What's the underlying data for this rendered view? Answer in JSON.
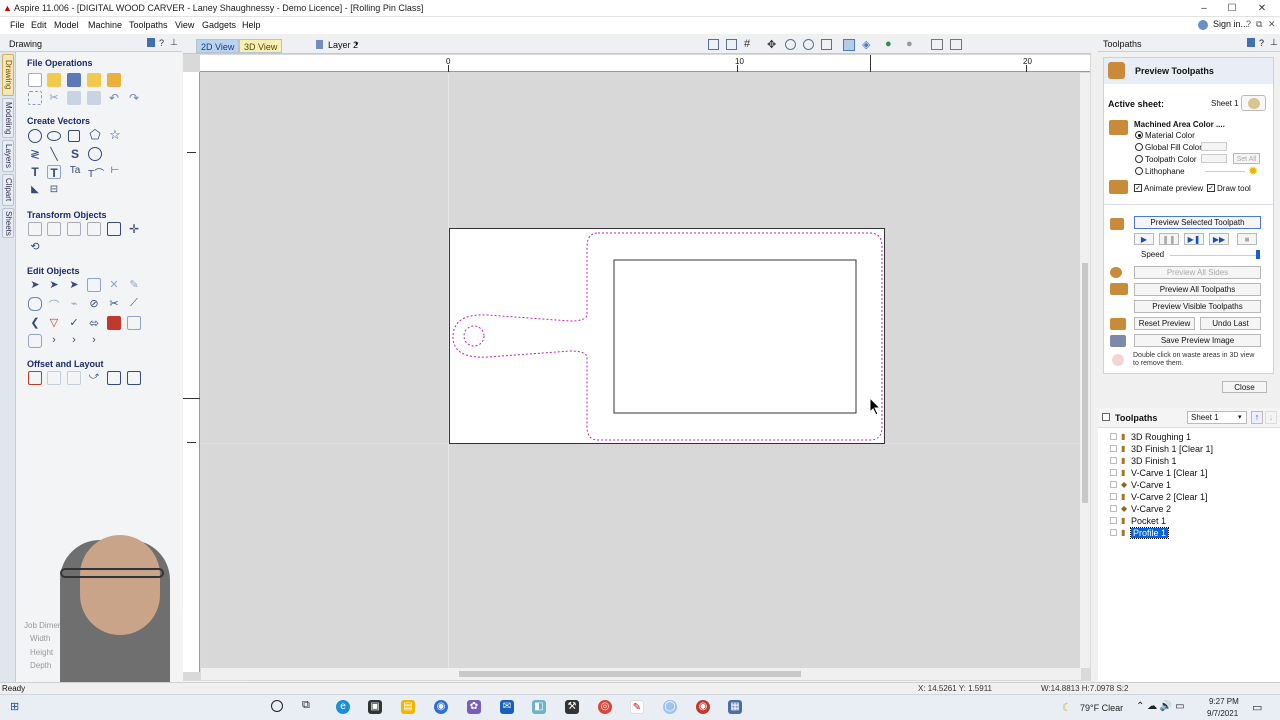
{
  "window": {
    "title": "Aspire 11.006 - [DIGITAL WOOD CARVER - Laney Shaughnessy - Demo Licence] - [Rolling Pin Class]",
    "controls": [
      "–",
      "☐",
      "✕"
    ]
  },
  "menu": {
    "items": [
      "File",
      "Edit",
      "Model",
      "Machine",
      "Toolpaths",
      "View",
      "Gadgets",
      "Help"
    ],
    "signin": "Sign in..."
  },
  "left_tabs": [
    "Drawing",
    "Modeling",
    "Layers",
    "Clipart",
    "Sheets"
  ],
  "drawing_panel": {
    "title": "Drawing",
    "sections": [
      {
        "title": "File Operations"
      },
      {
        "title": "Create Vectors"
      },
      {
        "title": "Transform Objects"
      },
      {
        "title": "Edit Objects"
      },
      {
        "title": "Offset and Layout"
      }
    ],
    "job_dimensions": {
      "title": "Job Dimen",
      "width": "Width",
      "height": "Height",
      "depth": "Depth"
    }
  },
  "view_tabs": {
    "tab_2d": "2D View",
    "tab_3d": "3D View",
    "layer": "Layer 2"
  },
  "ruler": {
    "labels": [
      "0",
      "10",
      "20"
    ]
  },
  "toolpaths_panel": {
    "title": "Toolpaths",
    "preview": {
      "heading": "Preview Toolpaths",
      "active_sheet_label": "Active sheet:",
      "active_sheet_value": "Sheet 1",
      "machined_area_label": "Machined Area Color ....",
      "color_options": [
        {
          "label": "Material Color",
          "selected": true
        },
        {
          "label": "Global Fill Color",
          "selected": false
        },
        {
          "label": "Toolpath Color",
          "selected": false
        },
        {
          "label": "Lithophane",
          "selected": false
        }
      ],
      "set_all": "Set All",
      "animate_preview": "Animate preview",
      "draw_tool": "Draw tool",
      "preview_selected": "Preview Selected Toolpath",
      "speed_label": "Speed",
      "preview_all_sides": "Preview All Sides",
      "preview_all_toolpaths": "Preview All Toolpaths",
      "preview_visible": "Preview Visible Toolpaths",
      "reset_preview": "Reset Preview",
      "undo_last": "Undo Last",
      "save_preview_image": "Save Preview Image",
      "hint": "Double click on waste areas in 3D view to remove them.",
      "close": "Close"
    },
    "list": {
      "title": "Toolpaths",
      "sheet": "Sheet 1",
      "items": [
        "3D Roughing 1",
        "3D Finish 1 [Clear 1]",
        "3D Finish 1",
        "V-Carve 1 [Clear 1]",
        "V-Carve 1",
        "V-Carve 2 [Clear 1]",
        "V-Carve 2",
        "Pocket 1",
        "Profile 1"
      ],
      "selected": "Profile 1"
    }
  },
  "status": {
    "left": "Ready",
    "coords": "X: 14.5261 Y: 1.5911",
    "dims": "W:14.8813  H:7.0978  S:2"
  },
  "taskbar": {
    "weather": "79°F  Clear",
    "time": "9:27 PM",
    "date": "9/7/2021"
  }
}
